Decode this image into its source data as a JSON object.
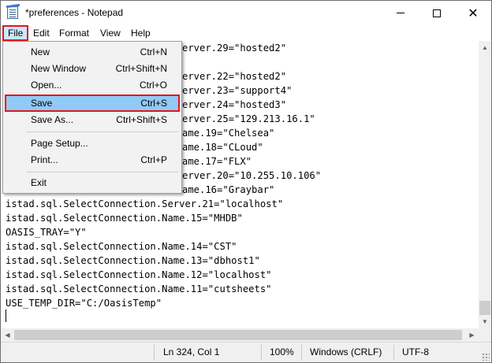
{
  "window": {
    "title": "*preferences - Notepad"
  },
  "menubar": [
    "File",
    "Edit",
    "Format",
    "View",
    "Help"
  ],
  "file_menu": {
    "items": [
      {
        "label": "New",
        "shortcut": "Ctrl+N"
      },
      {
        "label": "New Window",
        "shortcut": "Ctrl+Shift+N"
      },
      {
        "label": "Open...",
        "shortcut": "Ctrl+O"
      },
      {
        "label": "Save",
        "shortcut": "Ctrl+S"
      },
      {
        "label": "Save As...",
        "shortcut": "Ctrl+Shift+S"
      },
      {
        "label": "Page Setup...",
        "shortcut": ""
      },
      {
        "label": "Print...",
        "shortcut": "Ctrl+P"
      },
      {
        "label": "Exit",
        "shortcut": ""
      }
    ]
  },
  "editor": {
    "lines": [
      "erver.29=\"hosted2\"",
      "erver.22=\"hosted2\"",
      "erver.23=\"support4\"",
      "erver.24=\"hosted3\"",
      "erver.25=\"129.213.16.1\"",
      "ame.19=\"Chelsea\"",
      "ame.18=\"CLoud\"",
      "ame.17=\"FLX\"",
      "erver.20=\"10.255.10.106\"",
      "ame.16=\"Graybar\"",
      "istad.sql.SelectConnection.Server.21=\"localhost\"",
      "istad.sql.SelectConnection.Name.15=\"MHDB\"",
      "OASIS_TRAY=\"Y\"",
      "istad.sql.SelectConnection.Name.14=\"CST\"",
      "istad.sql.SelectConnection.Name.13=\"dbhost1\"",
      "istad.sql.SelectConnection.Name.12=\"localhost\"",
      "istad.sql.SelectConnection.Name.11=\"cutsheets\"",
      "USE_TEMP_DIR=\"C:/OasisTemp\""
    ]
  },
  "statusbar": {
    "position": "Ln 324, Col 1",
    "zoom": "100%",
    "line_ending": "Windows (CRLF)",
    "encoding": "UTF-8"
  }
}
